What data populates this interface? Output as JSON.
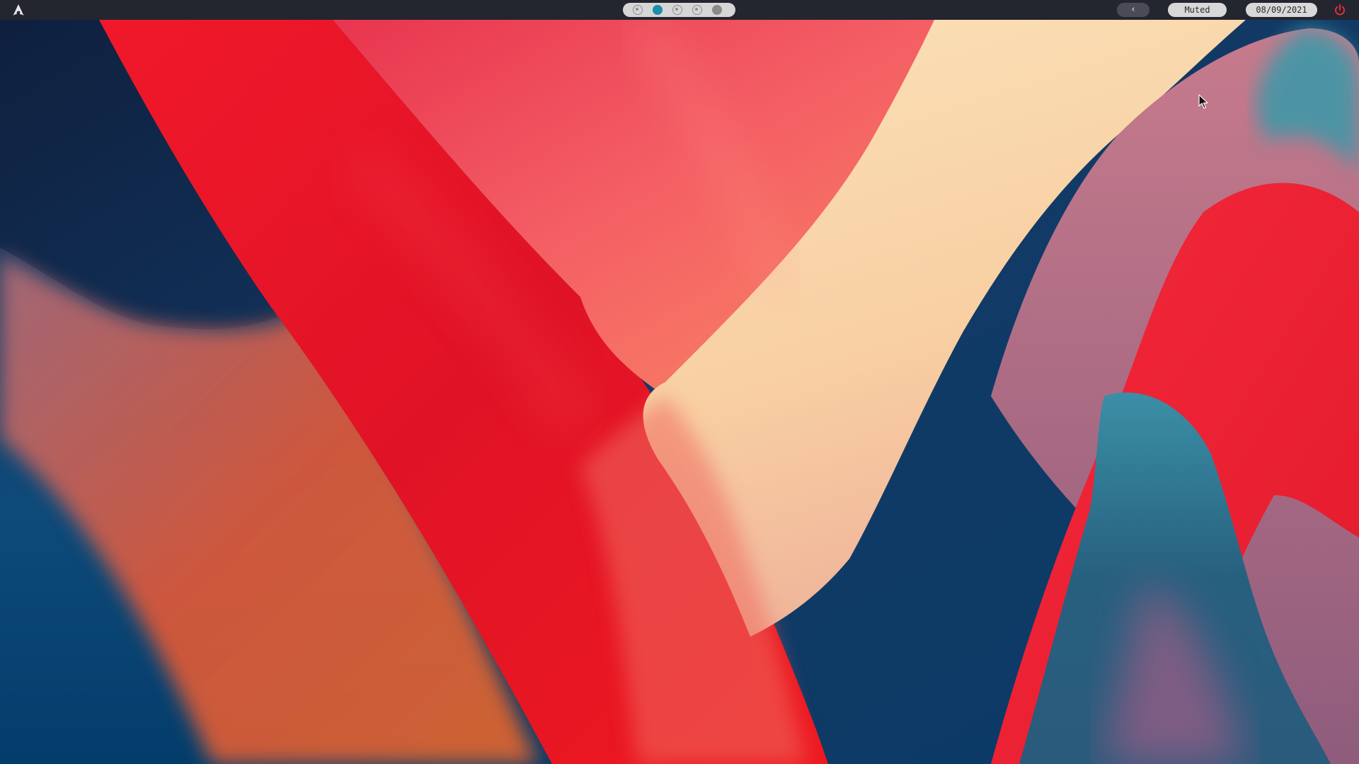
{
  "topbar": {
    "logo_icon": "arch-logo-icon",
    "workspaces": [
      {
        "state": "empty"
      },
      {
        "state": "active"
      },
      {
        "state": "empty"
      },
      {
        "state": "empty"
      },
      {
        "state": "occupied"
      }
    ],
    "tray_toggle_label": "‹",
    "volume_label": "Muted",
    "date_label": "08/09/2021",
    "power_icon": "power-icon"
  },
  "colors": {
    "bar": "#23252f",
    "active_workspace": "#1c8ea8",
    "power": "#e0303a"
  }
}
